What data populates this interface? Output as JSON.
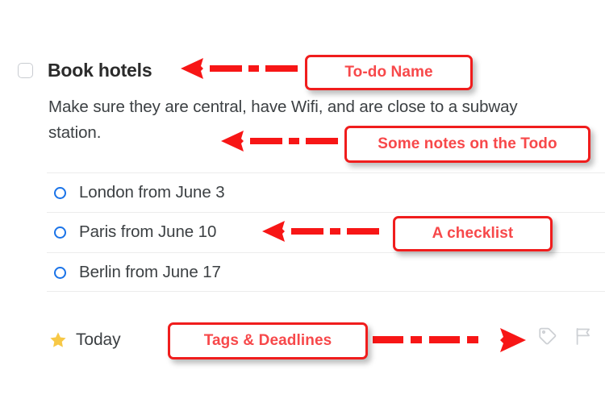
{
  "todo": {
    "checkbox_state": "unchecked",
    "title": "Book hotels",
    "notes": "Make sure they are central, have Wifi, and are close to a subway station.",
    "checklist": [
      {
        "state": "unchecked",
        "label": "London from June 3"
      },
      {
        "state": "unchecked",
        "label": "Paris from June 10"
      },
      {
        "state": "unchecked",
        "label": "Berlin from June 17"
      }
    ],
    "footer": {
      "star_icon": "star-icon",
      "deadline_label": "Today",
      "tag_icon": "tag-icon",
      "flag_icon": "flag-icon"
    }
  },
  "annotations": [
    {
      "id": "todo-name",
      "label": "To-do Name",
      "arrow": "left"
    },
    {
      "id": "todo-notes",
      "label": "Some notes on the Todo",
      "arrow": "left"
    },
    {
      "id": "todo-checklist",
      "label": "A checklist",
      "arrow": "left"
    },
    {
      "id": "todo-tags",
      "label": "Tags & Deadlines",
      "arrow": "right"
    }
  ],
  "colors": {
    "annotation_border": "#f01d1d",
    "annotation_text": "#f7484a",
    "arrow": "#f71616",
    "checklist_ring": "#1a73e8",
    "star": "#f7c846",
    "text": "#3c4043",
    "divider": "#ececec",
    "checkbox_border": "#c9ccd1"
  }
}
